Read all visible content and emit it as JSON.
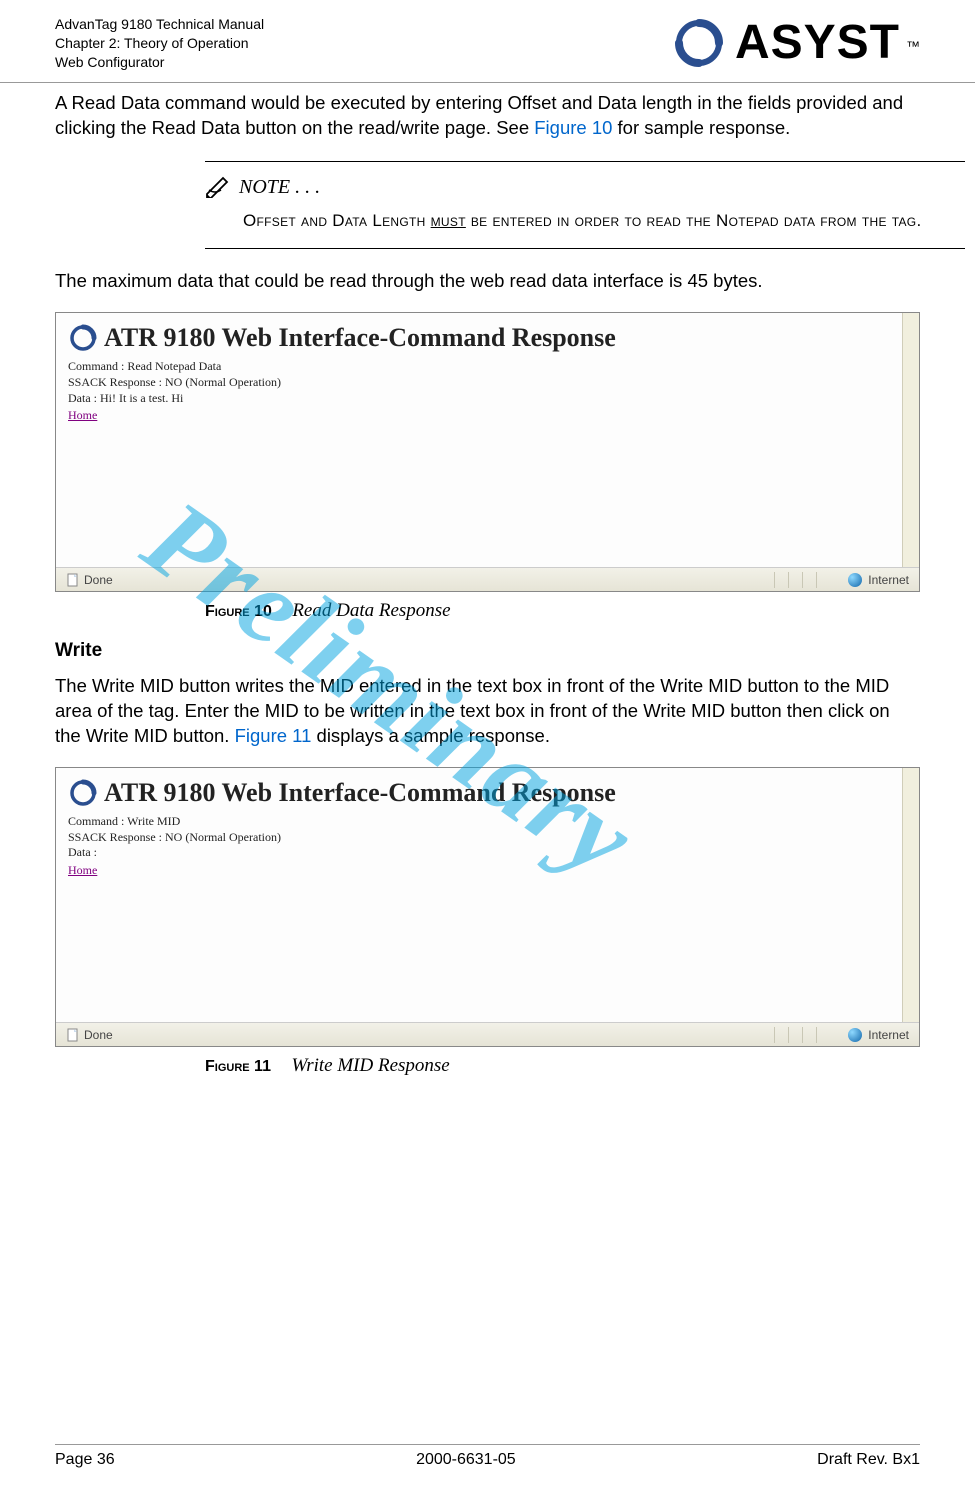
{
  "header": {
    "line1": "AdvanTag 9180 Technical Manual",
    "line2": "Chapter 2: Theory of Operation",
    "line3": "Web Configurator",
    "logo_text": "ASYST"
  },
  "intro": {
    "text_before_link": "A Read Data command would be executed by entering Offset and Data length in the fields provided and clicking the Read Data button on the read/write page. See ",
    "link_text": "Figure 10",
    "text_after_link": " for sample response."
  },
  "note": {
    "title": "NOTE . . .",
    "body_before_must": "Offset and Data Length ",
    "must": "must",
    "body_after_must": " be entered in order to read the Notepad data from the tag."
  },
  "max_data_text": "The maximum data that could be read through the web read data interface is 45 bytes.",
  "screenshot1": {
    "title": "ATR 9180 Web Interface-Command Response",
    "cmd_label": "Command :",
    "cmd_val": "Read Notepad Data",
    "ssack_label": "SSACK Response :",
    "ssack_val": "NO (Normal Operation)",
    "data_label": "Data :",
    "data_val": "Hi! It is a test. Hi",
    "home": "Home",
    "status_done": "Done",
    "status_zone": "Internet"
  },
  "figure10": {
    "label": "Figure 10",
    "caption": "Read Data Response"
  },
  "write_heading": "Write",
  "write_para": {
    "before_link": "The Write MID button writes the MID entered in the text box in front of the Write MID button to the MID area of the tag. Enter the MID to be written in the text box in front of the Write MID button then click on the Write MID button. ",
    "link_text": "Figure 11",
    "after_link": " displays a sample response."
  },
  "screenshot2": {
    "title": "ATR 9180 Web Interface-Command Response",
    "cmd_label": "Command :",
    "cmd_val": "Write MID",
    "ssack_label": "SSACK Response :",
    "ssack_val": "NO (Normal Operation)",
    "data_label": "Data :",
    "data_val": "",
    "home": "Home",
    "status_done": "Done",
    "status_zone": "Internet"
  },
  "figure11": {
    "label": "Figure 11",
    "caption": "Write MID Response"
  },
  "watermark": "Preliminary",
  "footer": {
    "left": "Page 36",
    "center": "2000-6631-05",
    "right": "Draft Rev. Bx1"
  }
}
